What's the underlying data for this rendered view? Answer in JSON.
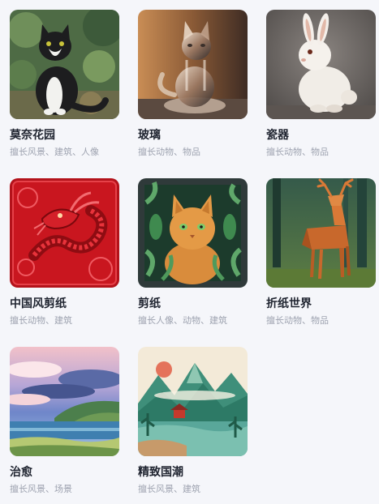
{
  "styles": [
    {
      "title": "莫奈花园",
      "desc": "擅长风景、建筑、人像",
      "image": "monet-style-tuxedo-cat"
    },
    {
      "title": "玻璃",
      "desc": "擅长动物、物品",
      "image": "glass-cat-figurine"
    },
    {
      "title": "瓷器",
      "desc": "擅长动物、物品",
      "image": "porcelain-rabbit"
    },
    {
      "title": "中国风剪纸",
      "desc": "擅长动物、建筑",
      "image": "red-paper-cut-dragon"
    },
    {
      "title": "剪纸",
      "desc": "擅长人像、动物、建筑",
      "image": "paper-cut-cat"
    },
    {
      "title": "折纸世界",
      "desc": "擅长动物、物品",
      "image": "origami-deer"
    },
    {
      "title": "治愈",
      "desc": "擅长风景、场景",
      "image": "anime-seaside-landscape"
    },
    {
      "title": "精致国潮",
      "desc": "擅长风景、建筑",
      "image": "chinese-mountain-landscape"
    }
  ]
}
